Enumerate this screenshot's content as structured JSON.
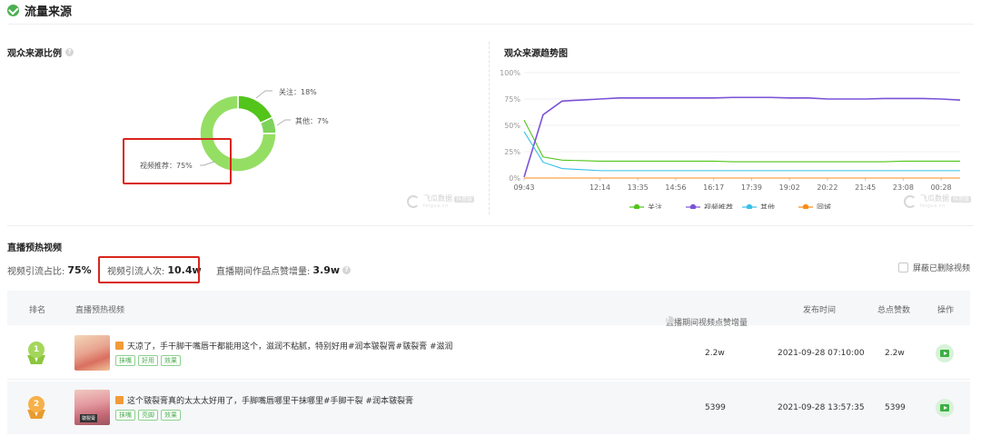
{
  "section": {
    "title": "流量来源"
  },
  "left_panel": {
    "title": "观众来源比例",
    "slices": [
      {
        "label": "关注：18%",
        "name": "关注",
        "value": 18,
        "color": "#52c41a"
      },
      {
        "label": "其他：7%",
        "name": "其他",
        "value": 7,
        "color": "#7dd35a"
      },
      {
        "label": "视频推荐：75%",
        "name": "视频推荐",
        "value": 75,
        "color": "#95de64"
      }
    ]
  },
  "right_panel": {
    "title": "观众来源趋势图"
  },
  "watermark": {
    "text": "飞瓜数据",
    "badge": "抖音版",
    "sub": "feigua.cn"
  },
  "chart_data": {
    "type": "line",
    "x": [
      "09:43",
      "10:20",
      "10:58",
      "11:36",
      "12:14",
      "12:54",
      "13:35",
      "14:15",
      "14:56",
      "15:36",
      "16:17",
      "16:58",
      "17:39",
      "18:20",
      "19:02",
      "19:41",
      "20:22",
      "21:03",
      "21:45",
      "22:26",
      "23:08",
      "23:48",
      "00:28",
      "00:40"
    ],
    "xticks": [
      "09:43",
      "12:14",
      "13:35",
      "14:56",
      "16:17",
      "17:39",
      "19:02",
      "20:22",
      "21:45",
      "23:08",
      "00:28"
    ],
    "yticks": [
      "0%",
      "25%",
      "50%",
      "75%",
      "100%"
    ],
    "ylim": [
      0,
      100
    ],
    "grid": true,
    "legend_position": "bottom",
    "series": [
      {
        "name": "关注",
        "color": "#52c41a",
        "values": [
          55,
          20,
          17,
          16.5,
          16,
          16,
          16,
          16,
          16,
          16,
          16,
          15.5,
          15.5,
          15.5,
          15.5,
          15.5,
          15.5,
          15.5,
          15.5,
          15.5,
          16,
          16,
          16,
          16
        ]
      },
      {
        "name": "视频推荐",
        "color": "#7b52d9",
        "values": [
          1,
          60,
          73,
          74,
          75,
          76,
          76,
          76,
          76,
          76,
          76,
          76.5,
          76.5,
          76.5,
          76,
          76,
          75,
          75,
          75,
          75.5,
          75.5,
          75.5,
          75,
          74
        ]
      },
      {
        "name": "其他",
        "color": "#36c0e8",
        "values": [
          44,
          15,
          9,
          8,
          7,
          7,
          7,
          7,
          7,
          7,
          7,
          7,
          7,
          7,
          7,
          7,
          7,
          7,
          7,
          7,
          7,
          7,
          7,
          7
        ]
      },
      {
        "name": "同城",
        "color": "#fa8c16",
        "values": [
          0,
          0,
          0,
          0,
          0,
          0,
          0,
          0,
          0,
          0,
          0,
          0,
          0,
          0,
          0,
          0,
          0,
          0,
          0,
          0,
          0,
          0,
          0,
          0
        ]
      }
    ]
  },
  "preheat": {
    "title": "直播预热视频",
    "ratio_label": "视频引流占比:",
    "ratio_value": "75%",
    "count_label": "视频引流人次:",
    "count_value": "10.4w",
    "likes_label": "直播期间作品点赞增量:",
    "likes_value": "3.9w",
    "hide_deleted": "屏蔽已删除视频"
  },
  "table": {
    "headers": {
      "rank": "排名",
      "video": "直播预热视频",
      "likes_inc": "直播期间视频点赞增量",
      "publish_time": "发布时间",
      "total_likes": "总点赞数",
      "action": "操作"
    },
    "rows": [
      {
        "rank": "1",
        "medal_color": "#a5d65c",
        "thumb_label": "",
        "title": "天凉了，手干脚干嘴唇干都能用这个，滋润不粘腻，特别好用#润本皲裂膏#皲裂膏 #滋润",
        "tags": [
          "抹嘴",
          "好用",
          "效果"
        ],
        "likes_inc": "2.2w",
        "publish_time": "2021-09-28 07:10:00",
        "total_likes": "2.2w"
      },
      {
        "rank": "2",
        "medal_color": "#f6b04a",
        "thumb_label": "皲裂膏",
        "title": "这个皲裂膏真的太太太好用了，手脚嘴唇哪里干抹哪里#手脚干裂 #润本皲裂膏",
        "tags": [
          "抹嘴",
          "亮脚",
          "效果"
        ],
        "likes_inc": "5399",
        "publish_time": "2021-09-28 13:57:35",
        "total_likes": "5399"
      }
    ]
  }
}
